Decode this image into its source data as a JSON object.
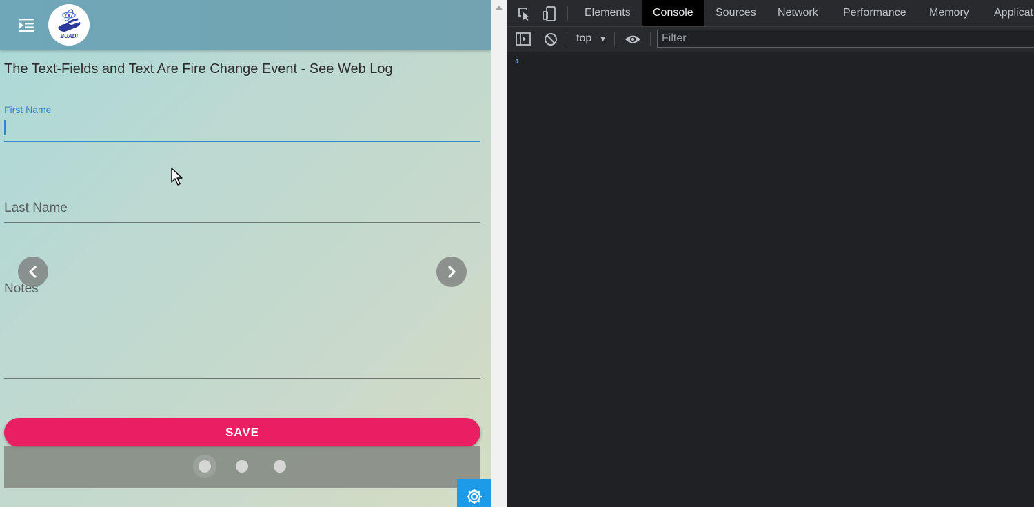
{
  "app": {
    "heading": "The Text-Fields and Text Are Fire Change Event - See Web Log",
    "logo_text": "BUADI",
    "fields": {
      "first_name": {
        "label": "First Name",
        "value": ""
      },
      "last_name": {
        "label": "Last Name",
        "value": ""
      },
      "notes": {
        "label": "Notes",
        "value": ""
      }
    },
    "save_label": "SAVE",
    "pager": {
      "count": 3,
      "active_index": 0
    },
    "colors": {
      "accent": "#e91e63",
      "focus": "#2f86cf",
      "header": "#6fa7b8",
      "settings": "#1e9be8"
    },
    "icons": [
      "menu-icon",
      "chevron-left-icon",
      "chevron-right-icon",
      "gear-icon"
    ]
  },
  "devtools": {
    "tabs": [
      "Elements",
      "Console",
      "Sources",
      "Network",
      "Performance",
      "Memory",
      "Applicat"
    ],
    "active_tab": "Console",
    "context": "top",
    "filter_placeholder": "Filter",
    "prompt": "›"
  }
}
